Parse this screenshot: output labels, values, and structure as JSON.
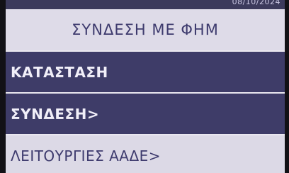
{
  "status": {
    "date": "08/10/2024"
  },
  "header": {
    "title": "ΣΥΝΔΕΣΗ ΜΕ ΦΗΜ"
  },
  "menu": {
    "items": [
      {
        "label": "ΚΑΤΑΣΤΑΣΗ",
        "style": "dark",
        "color": "#3e3c68"
      },
      {
        "label": "ΣΥΝΔΕΣΗ>",
        "style": "dark",
        "color": "#3e3c68"
      },
      {
        "label": "ΛΕΙΤΟΥΡΓΙΕΣ ΑΑΔΕ>",
        "style": "light",
        "color": "#dcd9e6"
      }
    ]
  }
}
